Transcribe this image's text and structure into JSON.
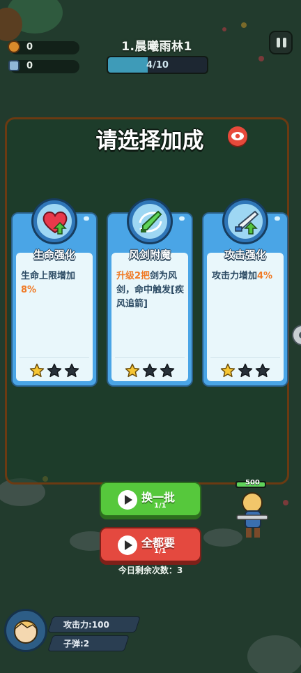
{
  "hud": {
    "resource_1": "0",
    "resource_2": "0",
    "level_name": "1.晨曦雨林1",
    "wave_progress": "4/10",
    "wave_progress_fraction": 0.4
  },
  "panel": {
    "title": "请选择加成"
  },
  "cards": [
    {
      "name": "生命强化",
      "icon": "heart-up-icon",
      "desc_parts": [
        {
          "t": "生命上限增加",
          "hl": false
        },
        {
          "t": "8%",
          "hl": true
        }
      ],
      "stars_filled": 1,
      "stars_total": 3
    },
    {
      "name": "风剑附魔",
      "icon": "wind-sword-icon",
      "desc_parts": [
        {
          "t": "升级2把",
          "hl": true
        },
        {
          "t": "剑为风剑，命中触发[疾风追箭]",
          "hl": false
        }
      ],
      "stars_filled": 1,
      "stars_total": 3
    },
    {
      "name": "攻击强化",
      "icon": "sword-up-icon",
      "desc_parts": [
        {
          "t": "攻击力增加",
          "hl": false
        },
        {
          "t": "4%",
          "hl": true
        }
      ],
      "stars_filled": 1,
      "stars_total": 3
    }
  ],
  "buttons": {
    "refresh_label": "换一批",
    "refresh_count": "1/1",
    "take_all_label": "全都要",
    "take_all_count": "1/1"
  },
  "remaining_text": "今日剩余次数：3",
  "player": {
    "hp_label": "500",
    "attack_label": "攻击力:100",
    "ammo_label": "子弹:2"
  },
  "colors": {
    "highlight": "#f07a25",
    "card_blue": "#4aa5e6",
    "green_button": "#56c83c",
    "red_button": "#e4493f"
  }
}
